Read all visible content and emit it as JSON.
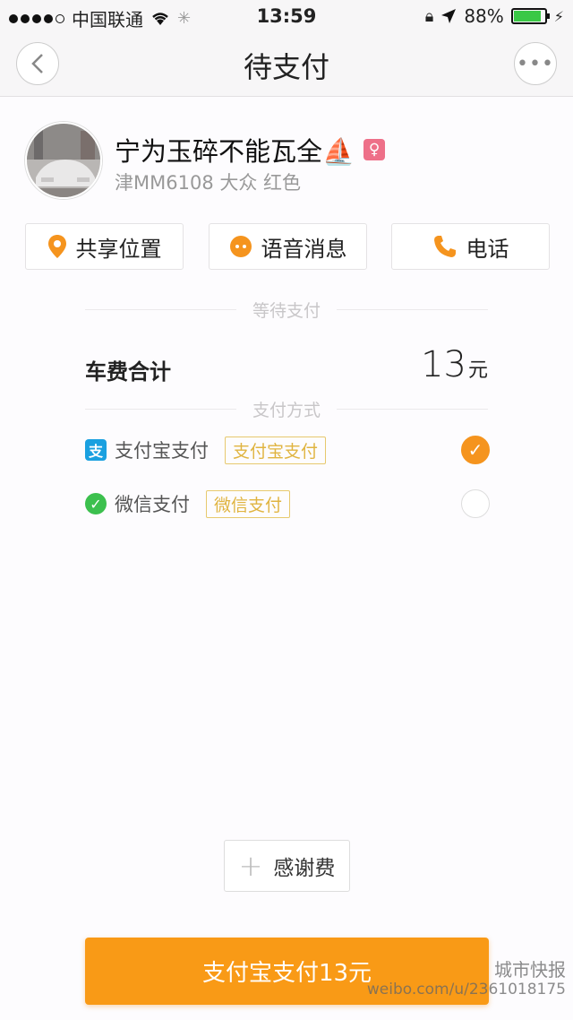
{
  "status_bar": {
    "carrier": "中国联通",
    "time": "13:59",
    "battery": "88%",
    "battery_level": 0.88
  },
  "nav": {
    "title": "待支付"
  },
  "driver": {
    "name": "宁为玉碎不能瓦全⛵",
    "gender": "♀",
    "car_info": "津MM6108 大众 红色"
  },
  "actions": {
    "share_location": "共享位置",
    "voice_message": "语音消息",
    "phone": "电话"
  },
  "section_waiting": "等待支付",
  "fare": {
    "label": "车费合计",
    "amount": "13",
    "unit": "元"
  },
  "section_payment": "支付方式",
  "payment_methods": [
    {
      "name": "支付宝支付",
      "tag": "支付宝支付",
      "icon": "支",
      "icon_color": "#1aa0e0",
      "selected": true
    },
    {
      "name": "微信支付",
      "tag": "微信支付",
      "icon": "✓",
      "icon_color": "#3cc04e",
      "selected": false
    }
  ],
  "tip_button": "感谢费",
  "pay_button": "支付宝支付13元",
  "watermark": {
    "name": "城市快报",
    "url": "weibo.com/u/2361018175"
  },
  "colors": {
    "accent": "#f99a16",
    "check": "#f5941e"
  }
}
